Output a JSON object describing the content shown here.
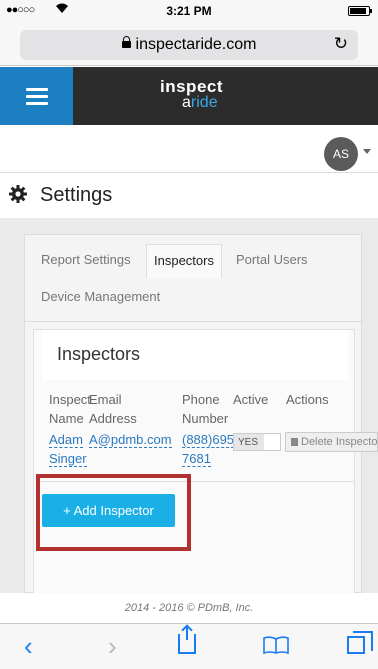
{
  "status_bar": {
    "signal": "●●○○○",
    "time": "3:21 PM"
  },
  "browser": {
    "url": "inspectaride.com"
  },
  "app": {
    "logo_line1": "inspect",
    "logo_line2_a": "a",
    "logo_line2_b": "ride",
    "user_initials": "AS"
  },
  "page": {
    "title": "Settings"
  },
  "tabs": [
    {
      "label": "Report Settings",
      "active": false
    },
    {
      "label": "Inspectors",
      "active": true
    },
    {
      "label": "Portal Users",
      "active": false
    },
    {
      "label": "Device Management",
      "active": false
    }
  ],
  "card": {
    "title": "Inspectors"
  },
  "table": {
    "headers": [
      {
        "line1": "Inspector",
        "line2": "Name"
      },
      {
        "line1": "Email",
        "line2": "Address"
      },
      {
        "line1": "Phone",
        "line2": "Number"
      },
      {
        "line1": "Active",
        "line2": ""
      },
      {
        "line1": "Actions",
        "line2": ""
      }
    ],
    "rows": [
      {
        "name_line1": "Adam",
        "name_line2": "Singer",
        "email": "A@pdmb.com",
        "phone_line1": "(888)695",
        "phone_line2": "7681",
        "active": "YES",
        "delete_label": "Delete Inspector"
      }
    ]
  },
  "add_button": {
    "label": "+ Add Inspector"
  },
  "footer": {
    "text": "2014 - 2016 © PDmB, Inc."
  },
  "colors": {
    "brand_blue": "#1c7fc2",
    "button_blue": "#1ab0e6",
    "highlight_red": "#b13131"
  }
}
